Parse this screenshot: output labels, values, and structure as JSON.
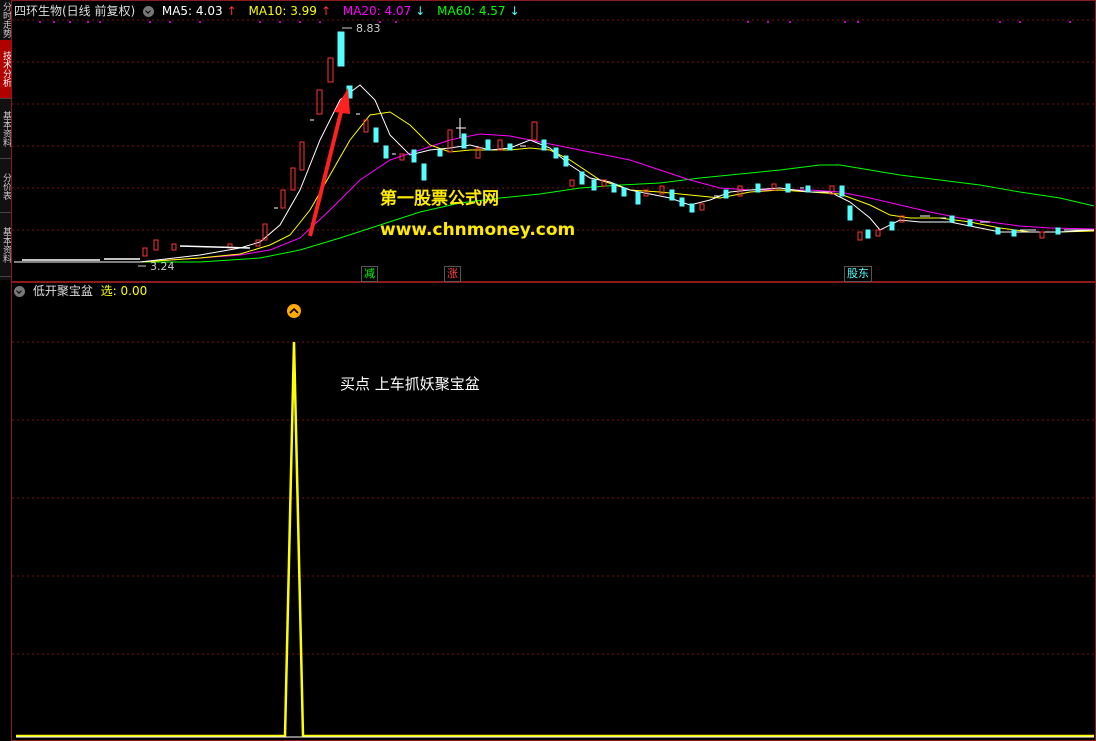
{
  "side_tabs": [
    "分时走势",
    "技术分析",
    "基本资料",
    "分价表",
    "基本资料"
  ],
  "top": {
    "title": "四环生物(日线 前复权)",
    "ma5": "MA5: 4.03",
    "ma5_arrow": "↑",
    "ma10": "MA10: 3.99",
    "ma10_arrow": "↑",
    "ma20": "MA20: 4.07",
    "ma20_arrow": "↓",
    "ma60": "MA60: 4.57",
    "ma60_arrow": "↓",
    "high_label": "8.83",
    "low_label": "3.24",
    "tags": [
      "减",
      "涨",
      "股东"
    ],
    "watermark_cn": "第一股票公式网",
    "watermark_url": "www.chnmoney.com",
    "colors": {
      "ma5": "#ffffff",
      "ma10": "#ffff00",
      "ma20": "#ff00ff",
      "ma60": "#00ff00",
      "up": "#ff3232",
      "down": "#54ffff",
      "grid": "#7a1010"
    }
  },
  "bottom": {
    "title": "低开聚宝盆",
    "select_label": "选: 0.00",
    "annotation": "买点 上车抓妖聚宝盆",
    "signal_icon": "up-arrow-circle-icon"
  }
}
